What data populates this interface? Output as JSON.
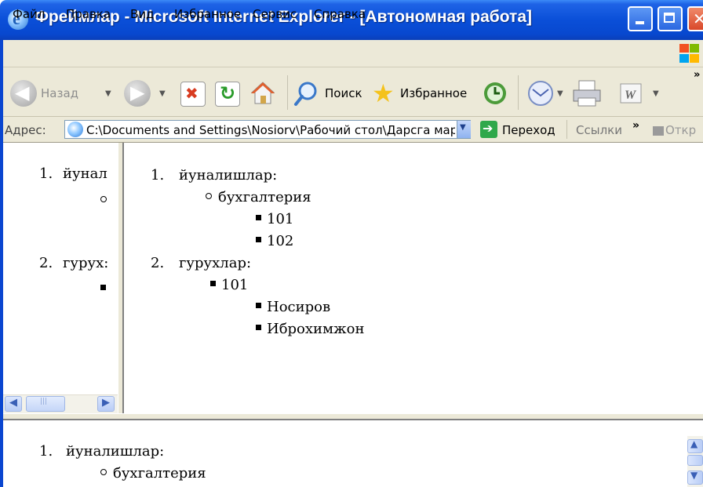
{
  "window": {
    "title": "Фреймлар - Microsoft Internet Explorer - [Автономная работа]"
  },
  "menu": {
    "items": [
      "Файл",
      "Правка",
      "Вид",
      "Избранное",
      "Сервис",
      "Справка"
    ]
  },
  "toolbar": {
    "back_label": "Назад",
    "search_label": "Поиск",
    "favorites_label": "Избранное"
  },
  "address": {
    "label": "Адрес:",
    "value": "C:\\Documents and Settings\\Nosiorv\\Рабочий стол\\Дарсга мару",
    "go_label": "Переход",
    "links_label": "Ссылки",
    "more": "»",
    "open_label": "Откр"
  },
  "frames": {
    "left": {
      "item1_num": "1.",
      "item1_text": "йунал",
      "item2_num": "2.",
      "item2_text": "гурух:"
    },
    "right": {
      "item1_num": "1.",
      "item1_text": "йуналишлар:",
      "sub1": "бухгалтерия",
      "sub1_items": [
        "101",
        "102"
      ],
      "item2_num": "2.",
      "item2_text": "гурухлар:",
      "sub2": "101",
      "sub2_items": [
        "Носиров",
        "Иброхимжон"
      ]
    },
    "bottom": {
      "item1_num": "1.",
      "item1_text": "йуналишлар:",
      "sub1": "бухгалтерия"
    }
  },
  "colors": {
    "titlebar": "#0a4fd8",
    "chrome": "#ece9d8"
  }
}
